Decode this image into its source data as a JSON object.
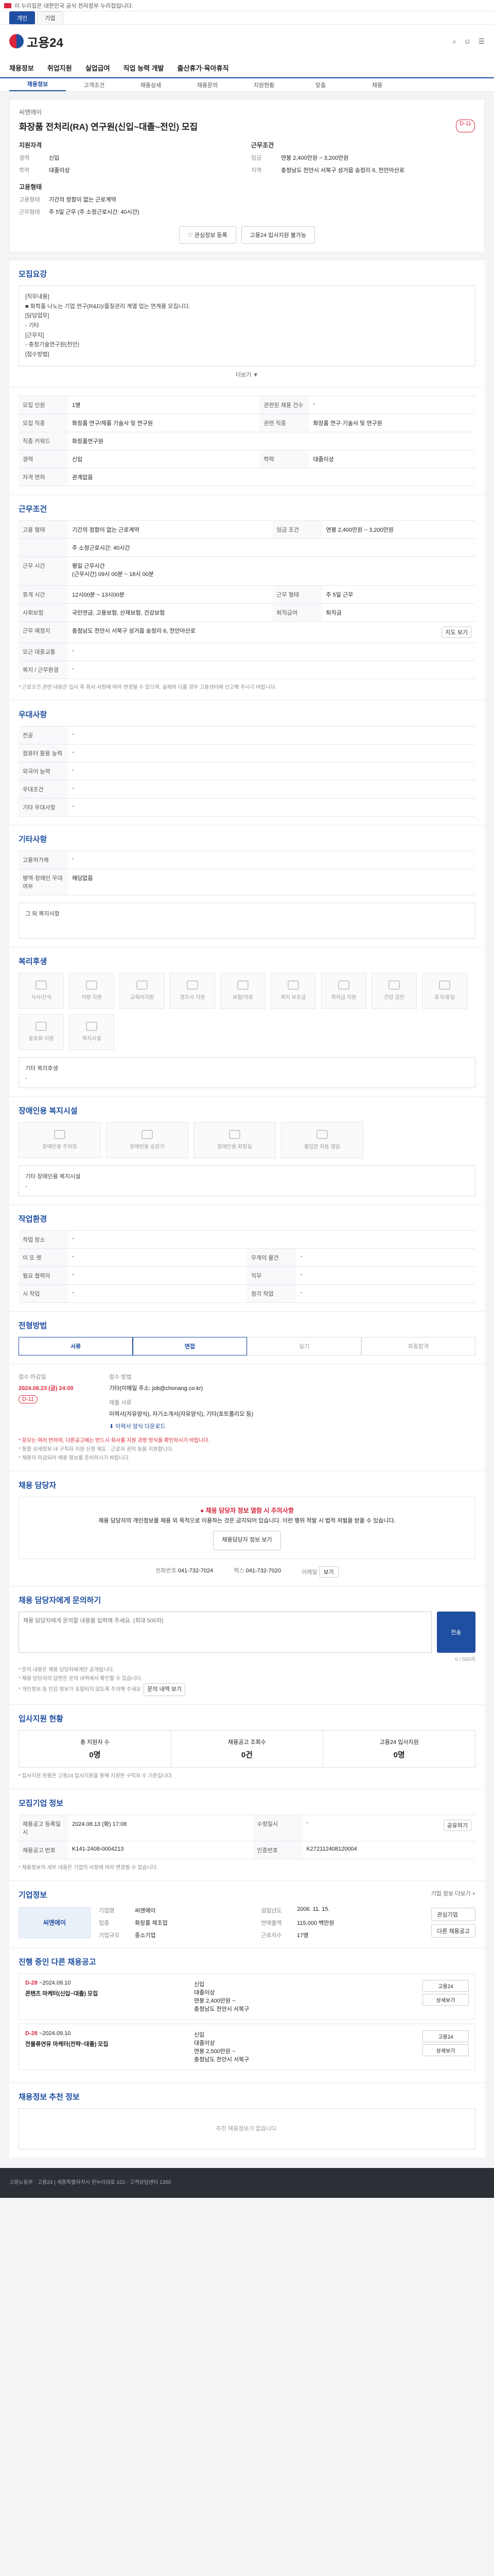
{
  "topbar": {
    "notice": "이 누리집은 대한민국 공식 전자정부 누리집입니다."
  },
  "browser_tabs": [
    "개인",
    "기업"
  ],
  "site": {
    "logo": "고용24",
    "brand_color": "#1f4fa1",
    "accent_red": "#d7263d"
  },
  "gnb": [
    "채용정보",
    "취업지원",
    "실업급여",
    "직업 능력 개발",
    "출산휴가·육아휴직"
  ],
  "subnav": [
    "채용정보",
    "고객조건",
    "채용상세",
    "채용문의",
    "지원현황",
    "맞춤",
    "채용"
  ],
  "hero": {
    "company": "씨앤에이",
    "title": "화장품 전처리(RA) 연구원(신입~대졸~전인) 모집",
    "dday": "D-11",
    "left": [
      {
        "k": "경력",
        "v": "신입"
      },
      {
        "k": "학력",
        "v": "대졸이상"
      }
    ],
    "right": [
      {
        "k": "임금",
        "v": "연봉 2,400만원 ~ 3,200만원"
      },
      {
        "k": "지역",
        "v": "충청남도 천안시 서북구 성거읍 송정리 6, 천안아산로"
      }
    ],
    "left_head": "지원자격",
    "right_head": "근무조건",
    "left2_head": "고용형태",
    "left2": [
      {
        "k": "고용형태",
        "v": "기간의 정함이 없는 근로계약"
      },
      {
        "k": "근무형태",
        "v": "주 5일 근무 (주 소정근로시간: 40시간)"
      }
    ],
    "btn_interest": "관심정보 등록",
    "btn_apply": "고용24 입사지원 불가능"
  },
  "summary": {
    "heading": "모집요강",
    "lines": [
      "[직무내용]",
      "■ 화학품 나노는 기업 연구(R&D)/품질관리 계열 업는 연계를 모집니다.",
      "[담당업무]",
      "- 기타",
      "[근무지]",
      "- 충청기술연구원(천안)",
      "[접수방법]"
    ],
    "more": "더보기 ▼"
  },
  "recruit": {
    "rows": [
      [
        "모집 인원",
        "1명",
        "관련된 채용 건수",
        "-"
      ],
      [
        "모집 직종",
        "화장품 연구/제품 기술사 및 연구원",
        "관련 직종",
        "화장품 연구·기술사 및 연구원"
      ],
      [
        "직종 키워드",
        "화장품연구원",
        "",
        ""
      ],
      [
        "경력",
        "신입",
        "학력",
        "대졸이상"
      ],
      [
        "자격 면허",
        "관계없음",
        "",
        ""
      ]
    ]
  },
  "work": {
    "heading": "근무조건",
    "rows": [
      [
        "고용 형태",
        "기간의 정함이 없는 근로계약",
        "임금 조건",
        "연봉 2,400만원 ~ 3,200만원"
      ],
      [
        "",
        "주 소정근로시간: 40시간",
        "",
        ""
      ],
      [
        "근무 시간",
        "평일 근무시간\n(근무시간) 09시 00분 ~ 18시 00분",
        "",
        ""
      ],
      [
        "휴게 시간",
        "",
        "",
        ""
      ],
      [
        "휴게 시간",
        "12시00분 ~ 13시00분",
        "근무 형태",
        "주 5일 근무"
      ],
      [
        "사회보험",
        "국민연금, 고용보험, 산재보험, 건강보험",
        "퇴직급여",
        "퇴직금"
      ],
      [
        "근무 예정지",
        "충청남도 천안시 서북구 성거읍 송정리 6, 천안아산로",
        "",
        ""
      ],
      [
        "모근 대중교통",
        "-",
        "",
        ""
      ],
      [
        "복지 / 근무환경",
        "-",
        "",
        ""
      ]
    ],
    "map_btn": "지도 보기",
    "note": "* 근로조건 관련 내용은 입사 후 회사 사정에 따라 변경될 수 있으며, 실제와 다를 경우 고용센터에 신고해 주시기 바랍니다."
  },
  "prefer": {
    "heading": "우대사항",
    "rows": [
      [
        "전공",
        "-"
      ],
      [
        "컴퓨터 활용 능력",
        "-"
      ],
      [
        "외국어 능력",
        "-"
      ],
      [
        "우대조건",
        "-"
      ],
      [
        "기타 우대사항",
        "-"
      ]
    ]
  },
  "other": {
    "heading": "기타사항",
    "rows": [
      [
        "고용허가제",
        "-"
      ],
      [
        "병역·장애인 우대 여부",
        "해당없음"
      ]
    ],
    "related_label": "그 외 복지사항"
  },
  "welfare": {
    "heading": "복리후생",
    "items": [
      "식사/간식",
      "차량 지원",
      "교육비지원",
      "경조사 지원",
      "보험/의료",
      "복지 보조금",
      "학자금 지원",
      "건강 검진",
      "휴가/휴일",
      "동호회 지원",
      "복지시설"
    ],
    "extra_label": "기타 복리후생",
    "extra": "-"
  },
  "disabled": {
    "heading": "장애인용 복지시설",
    "items": [
      "장애인용 주차장",
      "장애인용 승강기",
      "장애인용 화장실",
      "출입문 자동 열림"
    ],
    "extra_label": "기타 장애인용 복지시설",
    "extra": "-"
  },
  "env": {
    "heading": "작업환경",
    "rows": [
      [
        "작업 장소",
        "-",
        "",
        ""
      ],
      [
        "이 또 렛",
        "-",
        "무게의 물건",
        "-"
      ],
      [
        "필요 협력자",
        "-",
        "직무",
        "-"
      ],
      [
        "시 작업",
        "-",
        "청각 작업",
        "-"
      ]
    ]
  },
  "process": {
    "heading": "전형방법",
    "steps": [
      "서류",
      "면접",
      "실기",
      "최종합격"
    ]
  },
  "apply": {
    "deadline_label": "접수 마감일",
    "deadline": "2024.08.23 (금) 24:00",
    "dday": "D-11",
    "method_label": "접수 방법",
    "method": "기타(이메일 주소: job@chonang.co.kr)",
    "docs_label": "제출 서류",
    "docs": "이력서(자유양식), 자기소개서(자유양식), 기타(포트폴리오 등)",
    "download": "이력서 양식 다운로드",
    "notes": [
      "* 응모는 여러 번하여, 다른공고에는 반드시 회사를 지원 과정 방식을 확인하시기 바랍니다.",
      "* 통합 상세정보 내 구직자 지원 신청 제도 · 근로자 권익 등을 지원합니다.",
      "* 채용이 마감되어 채용 정보를 준비하시기 바랍니다."
    ]
  },
  "contact": {
    "heading": "채용 담당자",
    "alert_title": "● 채용 담당자 정보 열람 시 주의사항",
    "alert_text": "채용 담당자의 개인정보를 채용 외 목적으로 이용하는 것은 금지되어 있습니다. 이런 행위 적발 시 법적 처벌을 받을 수 있습니다.",
    "btn_view": "채용담당자 정보 보기",
    "phone_label": "전화번호",
    "phone": "041-732-7024",
    "fax_label": "팩스",
    "fax": "041-732-7020",
    "email_label": "이메일",
    "email_btn": "보기"
  },
  "inquiry": {
    "heading": "채용 담당자에게 문의하기",
    "placeholder": "채용 담당자에게 문의할 내용을 입력해 주세요. (최대 500자)",
    "count": "0 / 500자",
    "send": "전송",
    "notes": [
      "* 문의 내용은 채용 담당자에게만 공개됩니다.",
      "* 채용 담당자의 답변은 문의 내역에서 확인할 수 있습니다.",
      "* 개인정보 등 민감 정보가 포함되지 않도록 주의해 주세요."
    ],
    "history_btn": "문의 내역 보기"
  },
  "status": {
    "heading": "입사지원 현황",
    "stats": [
      {
        "label": "총 지원자 수",
        "value": "0명"
      },
      {
        "label": "채용공고 조회수",
        "value": "0건"
      },
      {
        "label": "고용24 입사지원",
        "value": "0명"
      }
    ],
    "note": "* 입사지원 현황은 고용24 입사지원을 통해 지원한 구직자 수 기준입니다."
  },
  "meta": {
    "heading": "모집기업 정보",
    "rows": [
      [
        "채용공고 등록일시",
        "2024.08.13 (화) 17:08",
        "수정일시",
        "-"
      ],
      [
        "채용공고 번호",
        "K141-2408-0004213",
        "인증번호",
        "K272112408120004"
      ]
    ],
    "share_btn": "공유하기",
    "note": "* 채용정보의 세부 내용은 기업의 사정에 따라 변경될 수 있습니다."
  },
  "company": {
    "heading": "기업정보",
    "logo_text": "씨앤에이",
    "name": "씨앤에이",
    "industry": "화장품 제조업",
    "employees": "-",
    "type": "중소기업",
    "founded": "2006. 11. 15.",
    "sales": "115,000 백만원",
    "workers": "17명",
    "more": "기업 정보 더보기 +",
    "btn_interest": "관심기업",
    "btn_other": "다른 채용공고"
  },
  "related": {
    "heading": "진행 중인 다른 채용공고",
    "items": [
      {
        "dday": "D-28",
        "date": "~2024.09.10",
        "title": "콘텐츠 마케터(신입~대졸) 모집",
        "career": "신입",
        "edu": "대졸이상",
        "pay": "연봉 2,400만원 ~",
        "loc": "충청남도 천안시 서북구"
      },
      {
        "dday": "D-28",
        "date": "~2024.09.10",
        "title": "전물류연유 마케터(전략~대졸) 모집",
        "career": "신입",
        "edu": "대졸이상",
        "pay": "연봉 2,500만원 ~",
        "loc": "충청남도 천안시 서북구"
      }
    ],
    "btn_apply": "고용24",
    "btn_view": "상세보기"
  },
  "recommend": {
    "heading": "채용정보 추천 정보",
    "empty": "추천 채용정보가 없습니다."
  },
  "footer": {
    "text": "고용노동부 · 고용24 | 세종특별자치시 한누리대로 422 · 고객상담센터 1350"
  }
}
